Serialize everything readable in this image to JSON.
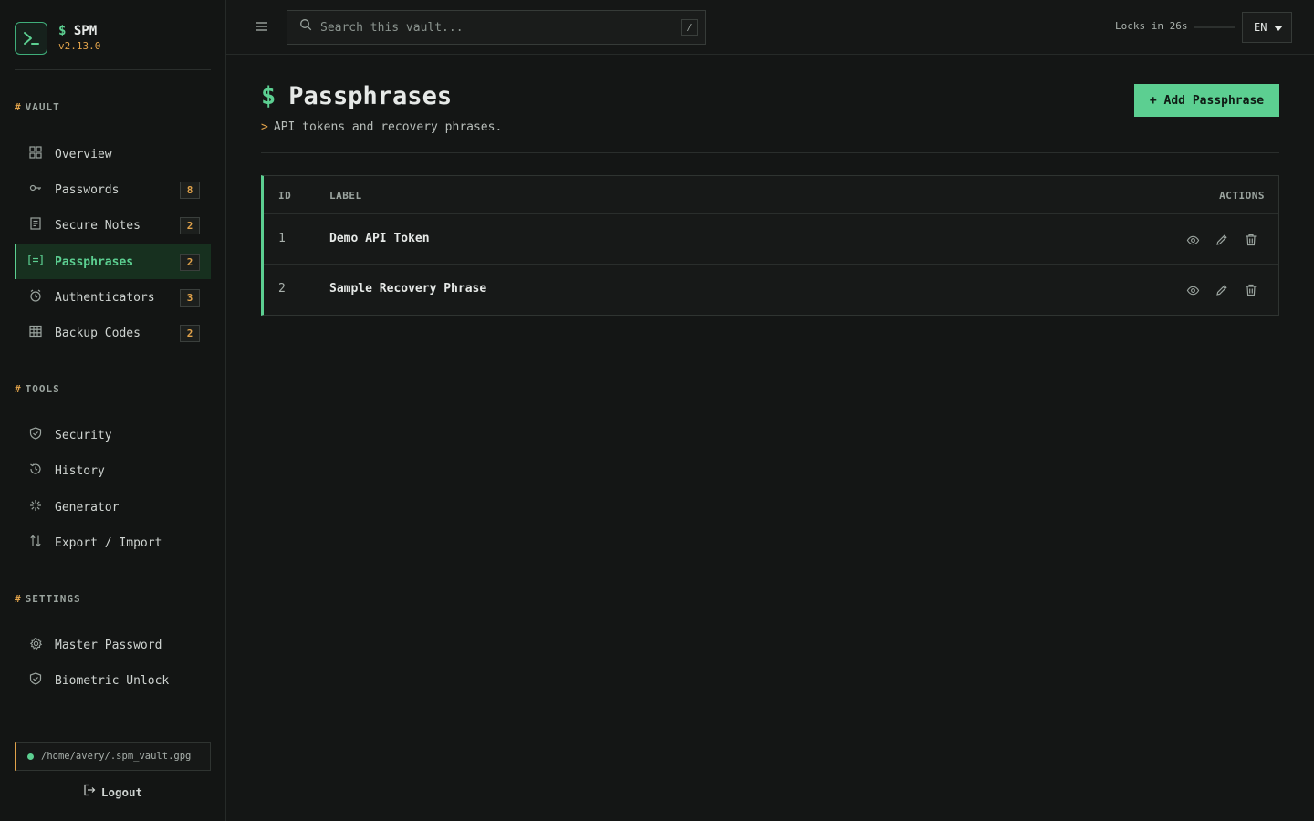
{
  "brand": {
    "prefix": "$",
    "name": "SPM",
    "version": "v2.13.0"
  },
  "sidebar": {
    "sections": [
      {
        "title": "VAULT"
      },
      {
        "title": "TOOLS"
      },
      {
        "title": "SETTINGS"
      }
    ],
    "vault_items": [
      {
        "label": "Overview",
        "icon": "grid-icon"
      },
      {
        "label": "Passwords",
        "icon": "key-icon",
        "badge": "8"
      },
      {
        "label": "Secure Notes",
        "icon": "note-icon",
        "badge": "2"
      },
      {
        "label": "Passphrases",
        "icon": "passphrase-icon",
        "badge": "2",
        "active": true
      },
      {
        "label": "Authenticators",
        "icon": "clock-icon",
        "badge": "3"
      },
      {
        "label": "Backup Codes",
        "icon": "table-icon",
        "badge": "2"
      }
    ],
    "tool_items": [
      {
        "label": "Security",
        "icon": "shield-icon"
      },
      {
        "label": "History",
        "icon": "history-icon"
      },
      {
        "label": "Generator",
        "icon": "sparkle-icon"
      },
      {
        "label": "Export / Import",
        "icon": "swap-icon"
      }
    ],
    "settings_items": [
      {
        "label": "Master Password",
        "icon": "gear-icon"
      },
      {
        "label": "Biometric Unlock",
        "icon": "shield-icon"
      }
    ],
    "vault_path": "/home/avery/.spm_vault.gpg",
    "logout_label": "Logout"
  },
  "topbar": {
    "search_placeholder": "Search this vault...",
    "search_shortcut": "/",
    "lock_text": "Locks in 26s",
    "lock_progress": 0.0,
    "language": "EN"
  },
  "page": {
    "title_prefix": "$",
    "title": "Passphrases",
    "subtitle_prefix": ">",
    "subtitle": "API tokens and recovery phrases.",
    "add_button": "+ Add Passphrase"
  },
  "table": {
    "headers": {
      "id": "ID",
      "label": "LABEL",
      "actions": "ACTIONS"
    },
    "rows": [
      {
        "id": "1",
        "label": "Demo API Token"
      },
      {
        "id": "2",
        "label": "Sample Recovery Phrase"
      }
    ]
  },
  "colors": {
    "accent": "#5ccf91",
    "warning": "#e0a24a",
    "background": "#141615"
  }
}
